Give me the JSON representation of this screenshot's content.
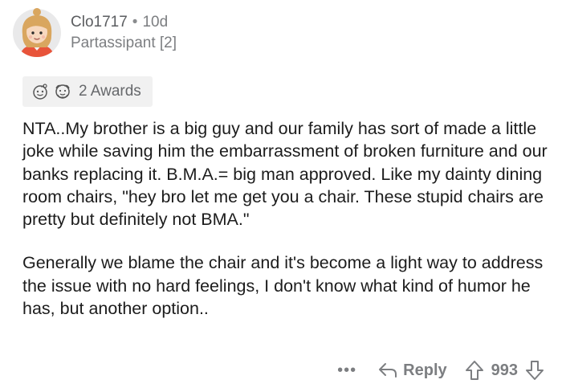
{
  "comment": {
    "username": "Clo1717",
    "separator": "•",
    "age": "10d",
    "flair": "Partassipant [2]",
    "awards": {
      "label": "2 Awards",
      "icons": [
        "wholesome-award-icon",
        "hugz-award-icon"
      ]
    },
    "paragraphs": [
      "NTA..My brother is a big guy and our family has sort of made a little joke while saving him the embarrassment of broken furniture and our banks replacing it. B.M.A.= big man approved. Like my dainty dining room chairs, \"hey bro let me get you a chair. These stupid chairs are pretty but definitely not BMA.\"",
      "Generally we blame the chair and it's become a light way to address the issue with no hard feelings, I don't know what kind of humor he has, but another option.."
    ],
    "actions": {
      "more": "•••",
      "reply_label": "Reply",
      "score": "993"
    }
  },
  "colors": {
    "text": "#1c1c1c",
    "meta": "#7c7e81",
    "award_bg": "#f1f1f1",
    "avatar_hair": "#d9a65f",
    "avatar_shirt": "#e8543a"
  }
}
